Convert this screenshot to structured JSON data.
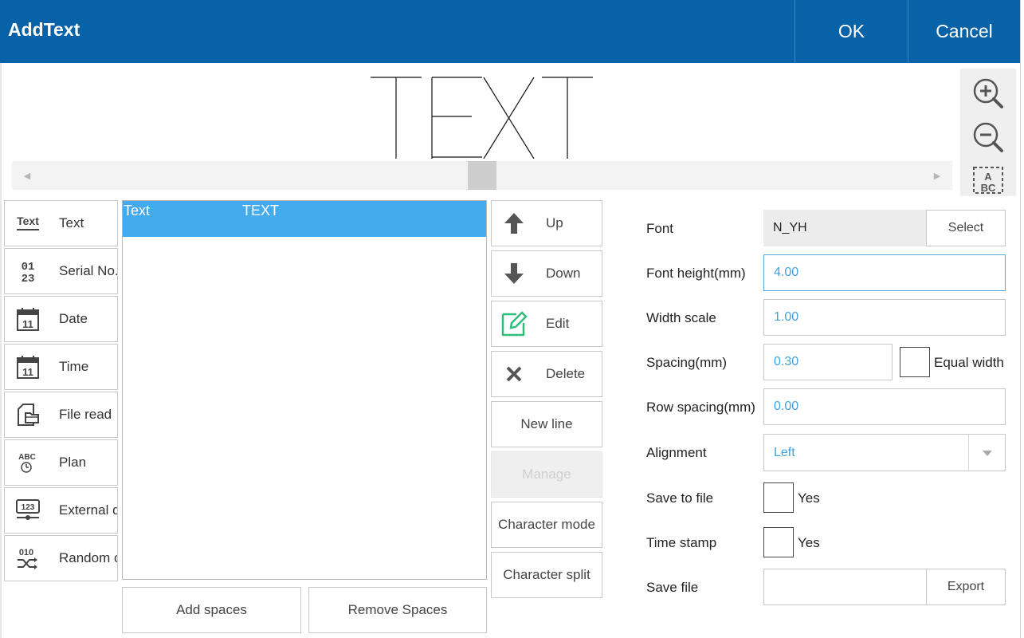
{
  "header": {
    "title": "AddText",
    "ok_label": "OK",
    "cancel_label": "Cancel"
  },
  "preview": {
    "text": "TEXT",
    "zoom_in_icon": "zoom-in-icon",
    "zoom_out_icon": "zoom-out-icon",
    "abc_label": "ABC"
  },
  "types": [
    {
      "label": "Text",
      "icon": "text-icon",
      "icon_text": "Text"
    },
    {
      "label": "Serial No.",
      "icon": "serial-number-icon",
      "icon_text": "01\n23"
    },
    {
      "label": "Date",
      "icon": "calendar-icon",
      "icon_text": "11"
    },
    {
      "label": "Time",
      "icon": "calendar-icon",
      "icon_text": "11"
    },
    {
      "label": "File read",
      "icon": "file-read-icon"
    },
    {
      "label": "Plan",
      "icon": "plan-icon",
      "icon_text": "ABC"
    },
    {
      "label": "External d",
      "icon": "external-data-icon",
      "icon_text": "123"
    },
    {
      "label": "Random c",
      "icon": "random-icon",
      "icon_text": "010"
    }
  ],
  "list": {
    "rows": [
      {
        "type": "Text",
        "content": "TEXT"
      }
    ]
  },
  "bottom": {
    "add_spaces": "Add spaces",
    "remove_spaces": "Remove Spaces"
  },
  "actions": {
    "up": "Up",
    "down": "Down",
    "edit": "Edit",
    "delete": "Delete",
    "new_line": "New line",
    "manage": "Manage",
    "character_mode": "Character mode",
    "character_split": "Character split"
  },
  "form": {
    "font_label": "Font",
    "font_value": "N_YH",
    "select_label": "Select",
    "font_height_label": "Font height(mm)",
    "font_height_value": "4.00",
    "width_scale_label": "Width scale",
    "width_scale_value": "1.00",
    "spacing_label": "Spacing(mm)",
    "spacing_value": "0.30",
    "equal_width_label": "Equal width",
    "row_spacing_label": "Row spacing(mm)",
    "row_spacing_value": "0.00",
    "alignment_label": "Alignment",
    "alignment_value": "Left",
    "save_to_file_label": "Save to file",
    "save_to_file_yes": "Yes",
    "time_stamp_label": "Time stamp",
    "time_stamp_yes": "Yes",
    "save_file_label": "Save file",
    "save_file_value": "",
    "export_label": "Export"
  },
  "colors": {
    "header_bg": "#0762a8",
    "selection": "#43aaee",
    "value_text": "#3da4e0",
    "edit_icon": "#2fbd7a"
  }
}
